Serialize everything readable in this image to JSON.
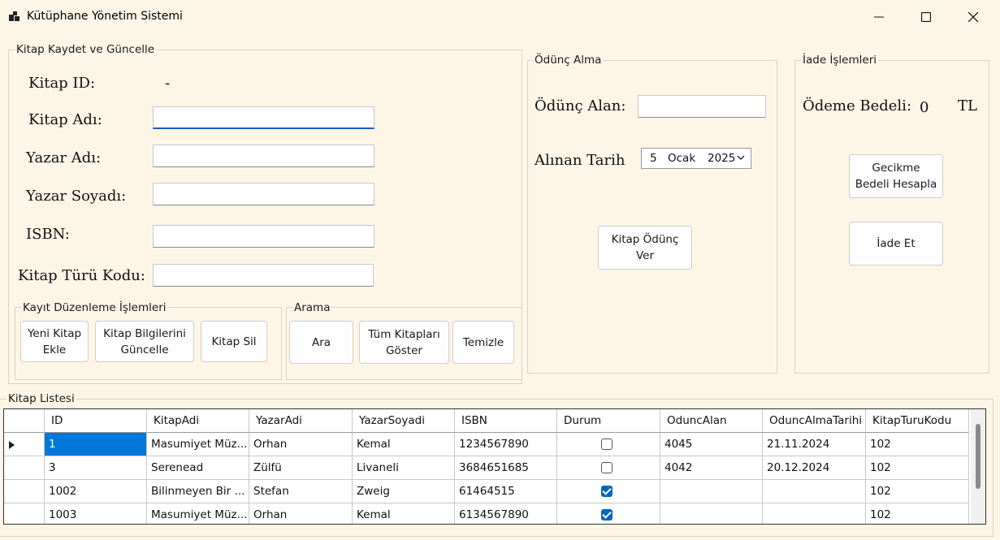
{
  "window": {
    "title": "Kütüphane Yönetim Sistemi"
  },
  "kaydet": {
    "group_title": "Kitap Kaydet ve Güncelle",
    "kitap_id_label": "Kitap ID:",
    "kitap_id_value": "-",
    "kitap_adi_label": "Kitap Adı:",
    "kitap_adi_value": "",
    "yazar_adi_label": "Yazar Adı:",
    "yazar_adi_value": "",
    "yazar_soyadi_label": "Yazar Soyadı:",
    "yazar_soyadi_value": "",
    "isbn_label": "ISBN:",
    "isbn_value": "",
    "kitap_turu_label": "Kitap Türü Kodu:",
    "kitap_turu_value": ""
  },
  "duzenleme": {
    "group_title": "Kayıt Düzenleme İşlemleri",
    "yeni_kitap": "Yeni Kitap\nEkle",
    "guncelle": "Kitap Bilgilerini\nGüncelle",
    "sil": "Kitap Sil"
  },
  "arama": {
    "group_title": "Arama",
    "ara": "Ara",
    "tum_kitaplar": "Tüm Kitapları\nGöster",
    "temizle": "Temizle"
  },
  "odunc": {
    "group_title": "Ödünç Alma",
    "alan_label": "Ödünç Alan:",
    "alan_value": "",
    "tarih_label": "Alınan Tarih",
    "tarih_day": "5",
    "tarih_month": "Ocak",
    "tarih_year": "2025",
    "ver_button": "Kitap Ödünç\nVer"
  },
  "iade": {
    "group_title": "İade İşlemleri",
    "bedel_label": "Ödeme Bedeli:",
    "bedel_value": "0",
    "currency": "TL",
    "hesapla_button": "Gecikme\nBedeli Hesapla",
    "iade_button": "İade Et"
  },
  "liste": {
    "group_title": "Kitap Listesi",
    "columns": [
      "ID",
      "KitapAdi",
      "YazarAdi",
      "YazarSoyadi",
      "ISBN",
      "Durum",
      "OduncAlan",
      "OduncAlmaTarihi",
      "KitapTuruKodu"
    ],
    "rows": [
      {
        "id": "1",
        "kitap_adi": "Masumiyet Müz...",
        "yazar_adi": "Orhan",
        "yazar_soyadi": "Kemal",
        "isbn": "1234567890",
        "durum": false,
        "odunc_alan": "4045",
        "odunc_tarihi": "21.11.2024",
        "tur_kodu": "102"
      },
      {
        "id": "3",
        "kitap_adi": "Serenead",
        "yazar_adi": "Zülfü",
        "yazar_soyadi": "Livaneli",
        "isbn": "3684651685",
        "durum": false,
        "odunc_alan": "4042",
        "odunc_tarihi": "20.12.2024",
        "tur_kodu": "102"
      },
      {
        "id": "1002",
        "kitap_adi": "Bilinmeyen Bir ...",
        "yazar_adi": "Stefan",
        "yazar_soyadi": "Zweig",
        "isbn": "61464515",
        "durum": true,
        "odunc_alan": "",
        "odunc_tarihi": "",
        "tur_kodu": "102"
      },
      {
        "id": "1003",
        "kitap_adi": "Masumiyet Müz...",
        "yazar_adi": "Orhan",
        "yazar_soyadi": "Kemal",
        "isbn": "6134567890",
        "durum": true,
        "odunc_alan": "",
        "odunc_tarihi": "",
        "tur_kodu": "102"
      }
    ]
  },
  "colors": {
    "accent": "#0078d7",
    "window_bg": "#fdf5e6",
    "checkbox_on": "#0067c0"
  }
}
